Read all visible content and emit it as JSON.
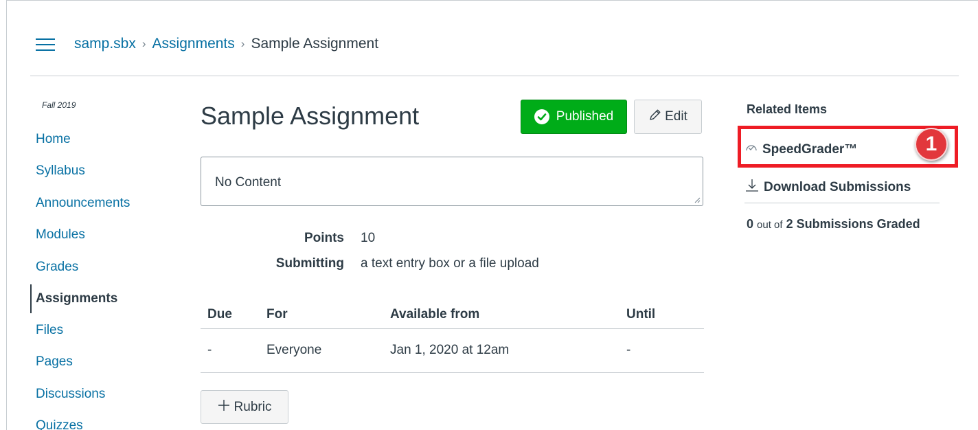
{
  "breadcrumb": {
    "course": "samp.sbx",
    "section": "Assignments",
    "current": "Sample Assignment",
    "separator": "›"
  },
  "sidebar": {
    "term": "Fall 2019",
    "items": [
      {
        "label": "Home"
      },
      {
        "label": "Syllabus"
      },
      {
        "label": "Announcements"
      },
      {
        "label": "Modules"
      },
      {
        "label": "Grades"
      },
      {
        "label": "Assignments",
        "active": true
      },
      {
        "label": "Files"
      },
      {
        "label": "Pages"
      },
      {
        "label": "Discussions"
      },
      {
        "label": "Quizzes"
      }
    ]
  },
  "assignment": {
    "title": "Sample Assignment",
    "published_label": "Published",
    "edit_label": "Edit",
    "content": "No Content",
    "points_label": "Points",
    "points_value": "10",
    "submitting_label": "Submitting",
    "submitting_value": "a text entry box or a file upload",
    "dates_headers": [
      "Due",
      "For",
      "Available from",
      "Until"
    ],
    "dates_row": [
      "-",
      "Everyone",
      "Jan 1, 2020 at 12am",
      "-"
    ],
    "rubric_label": "Rubric"
  },
  "related": {
    "title": "Related Items",
    "speedgrader_label": "SpeedGrader™",
    "download_label": "Download Submissions",
    "graded_count": "0",
    "graded_of": "out of",
    "graded_total": "2 Submissions Graded"
  },
  "annotation": {
    "step_number": "1",
    "color": "#ee1c25"
  },
  "colors": {
    "link": "#0770a3",
    "text": "#2d3b45",
    "published": "#00ac18"
  }
}
